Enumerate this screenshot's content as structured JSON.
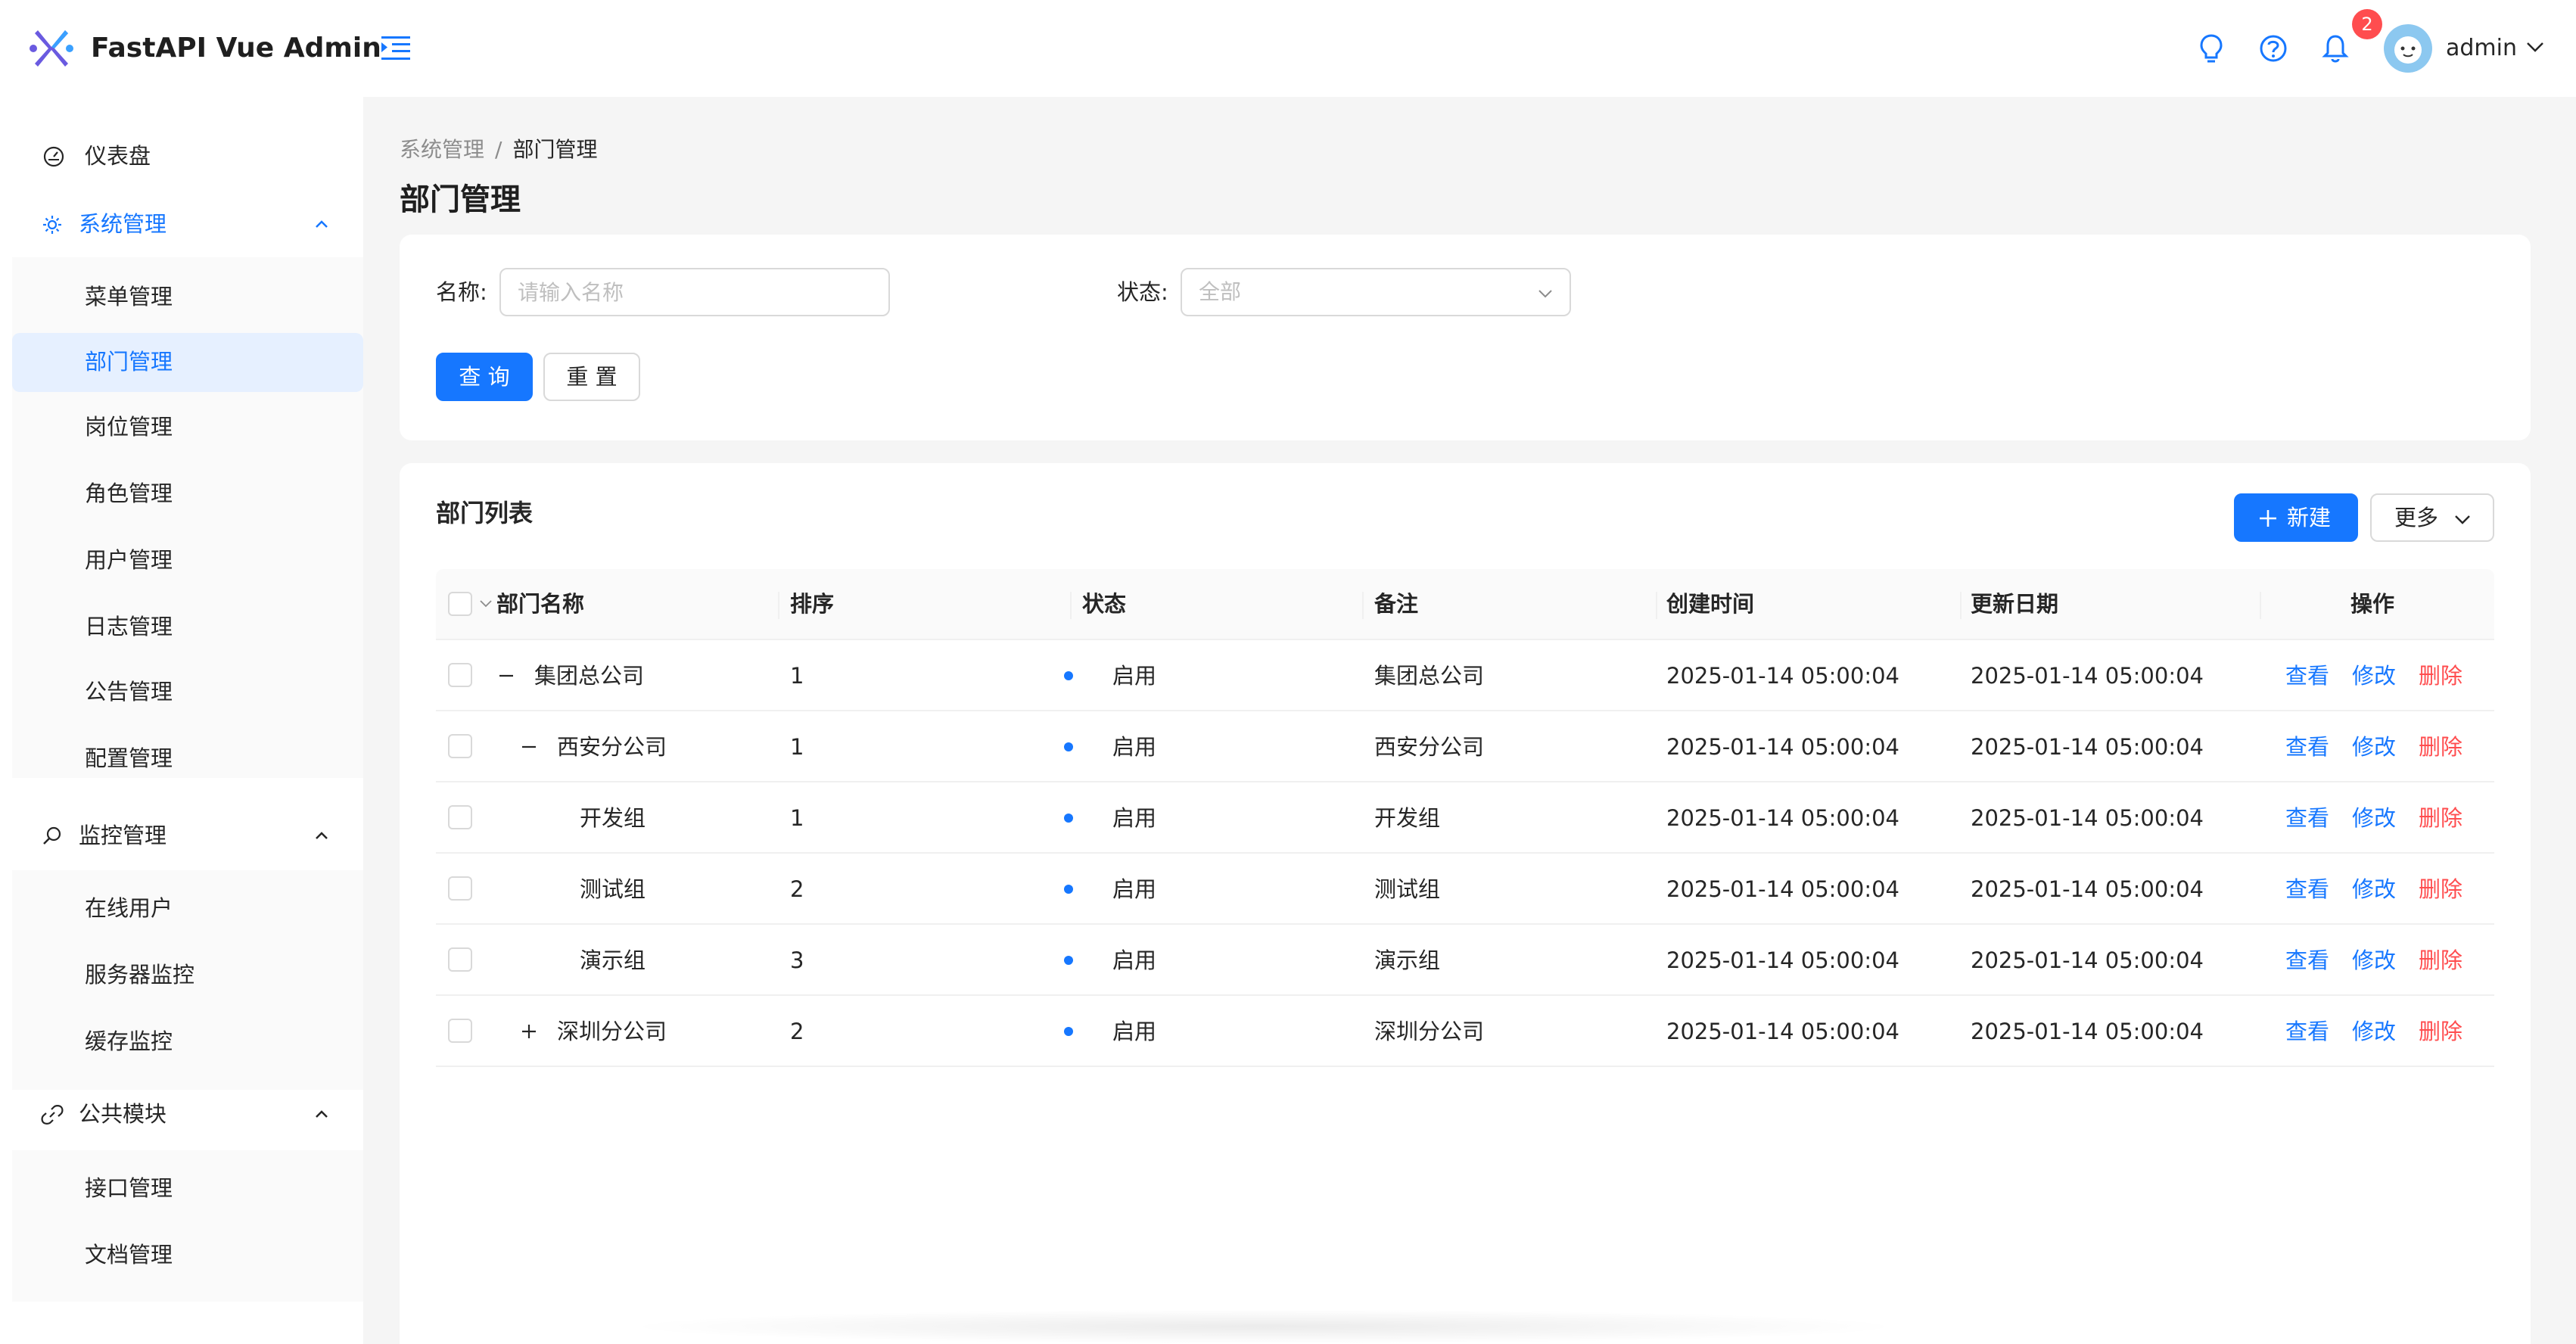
{
  "header": {
    "title": "FastAPI Vue Admin",
    "notification_count": "2",
    "user_name": "admin"
  },
  "sidebar": {
    "dashboard": "仪表盘",
    "system_group": "系统管理",
    "system_items": [
      "菜单管理",
      "部门管理",
      "岗位管理",
      "角色管理",
      "用户管理",
      "日志管理",
      "公告管理",
      "配置管理"
    ],
    "monitor_group": "监控管理",
    "monitor_items": [
      "在线用户",
      "服务器监控",
      "缓存监控"
    ],
    "public_group": "公共模块",
    "public_items": [
      "接口管理",
      "文档管理"
    ]
  },
  "breadcrumb": {
    "parent": "系统管理",
    "separator": "/",
    "current": "部门管理"
  },
  "page_title": "部门管理",
  "search": {
    "name_label": "名称:",
    "name_placeholder": "请输入名称",
    "status_label": "状态:",
    "status_value": "全部",
    "query_label": "查 询",
    "reset_label": "重 置"
  },
  "list": {
    "title": "部门列表",
    "new_label": "新建",
    "more_label": "更多",
    "columns": [
      "部门名称",
      "排序",
      "状态",
      "备注",
      "创建时间",
      "更新日期",
      "操作"
    ],
    "rows": [
      {
        "name": "集团总公司",
        "sort": "1",
        "status": "启用",
        "remark": "集团总公司",
        "created": "2025-01-14 05:00:04",
        "updated": "2025-01-14 05:00:04"
      },
      {
        "name": "西安分公司",
        "sort": "1",
        "status": "启用",
        "remark": "西安分公司",
        "created": "2025-01-14 05:00:04",
        "updated": "2025-01-14 05:00:04"
      },
      {
        "name": "开发组",
        "sort": "1",
        "status": "启用",
        "remark": "开发组",
        "created": "2025-01-14 05:00:04",
        "updated": "2025-01-14 05:00:04"
      },
      {
        "name": "测试组",
        "sort": "2",
        "status": "启用",
        "remark": "测试组",
        "created": "2025-01-14 05:00:04",
        "updated": "2025-01-14 05:00:04"
      },
      {
        "name": "演示组",
        "sort": "3",
        "status": "启用",
        "remark": "演示组",
        "created": "2025-01-14 05:00:04",
        "updated": "2025-01-14 05:00:04"
      },
      {
        "name": "深圳分公司",
        "sort": "2",
        "status": "启用",
        "remark": "深圳分公司",
        "created": "2025-01-14 05:00:04",
        "updated": "2025-01-14 05:00:04"
      }
    ],
    "actions": {
      "view": "查看",
      "edit": "修改",
      "delete": "删除"
    }
  },
  "colors": {
    "primary": "#1677ff",
    "danger": "#ff4d4f",
    "content_bg": "#f5f5f5"
  }
}
